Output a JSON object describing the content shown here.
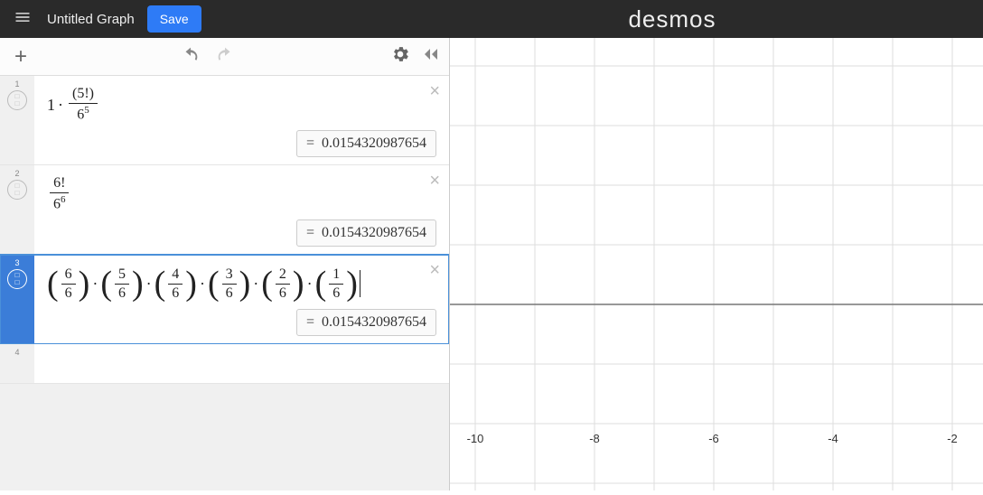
{
  "header": {
    "title": "Untitled Graph",
    "save_label": "Save",
    "logo": "desmos"
  },
  "expressions": [
    {
      "index": "1",
      "latex_parts": {
        "coef": "1",
        "num": "5!",
        "den_base": "6",
        "den_exp": "5"
      },
      "result_prefix": "=",
      "result": "0.0154320987654"
    },
    {
      "index": "2",
      "latex_parts": {
        "num": "6!",
        "den_base": "6",
        "den_exp": "6"
      },
      "result_prefix": "=",
      "result": "0.0154320987654"
    },
    {
      "index": "3",
      "fracs": [
        {
          "n": "6",
          "d": "6"
        },
        {
          "n": "5",
          "d": "6"
        },
        {
          "n": "4",
          "d": "6"
        },
        {
          "n": "3",
          "d": "6"
        },
        {
          "n": "2",
          "d": "6"
        },
        {
          "n": "1",
          "d": "6"
        }
      ],
      "result_prefix": "=",
      "result": "0.0154320987654",
      "active": true
    },
    {
      "index": "4",
      "empty": true
    }
  ],
  "axis": {
    "ticks": [
      "-10",
      "-8",
      "-6",
      "-4",
      "-2"
    ]
  }
}
